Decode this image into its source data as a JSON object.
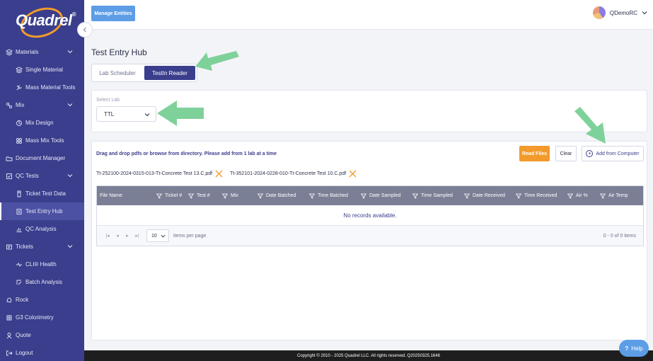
{
  "brand": {
    "name": "Quadrel",
    "reg": "®"
  },
  "topbar": {
    "manage_label": "Manage Entities",
    "user_name": "QDemoRC"
  },
  "sidebar": {
    "items": [
      {
        "label": "Materials",
        "level": "top",
        "icon": "layers-icon",
        "expandable": true
      },
      {
        "label": "Single Material",
        "level": "sub",
        "icon": "layers-icon"
      },
      {
        "label": "Mass Material Tools",
        "level": "sub",
        "icon": "tools-icon"
      },
      {
        "label": "Mix",
        "level": "top",
        "icon": "mix-icon",
        "expandable": true
      },
      {
        "label": "Mix Design",
        "level": "sub",
        "icon": "mix-design-icon"
      },
      {
        "label": "Mass Mix Tools",
        "level": "sub",
        "icon": "mass-mix-icon"
      },
      {
        "label": "Document Manager",
        "level": "top",
        "icon": "folder-icon"
      },
      {
        "label": "QC Tests",
        "level": "top",
        "icon": "qc-icon",
        "expandable": true
      },
      {
        "label": "Ticket Test Data",
        "level": "sub",
        "icon": "ticket-icon"
      },
      {
        "label": "Test Entry Hub",
        "level": "sub",
        "icon": "hub-icon",
        "active": true
      },
      {
        "label": "QC Analysis",
        "level": "sub",
        "icon": "chart-icon"
      },
      {
        "label": "Tickets",
        "level": "top",
        "icon": "tickets-icon",
        "expandable": true
      },
      {
        "label": "CLI® Health",
        "level": "sub",
        "icon": "health-icon"
      },
      {
        "label": "Batch Analysis",
        "level": "sub",
        "icon": "batch-icon"
      },
      {
        "label": "Rock",
        "level": "top",
        "icon": "rock-icon"
      },
      {
        "label": "G3 Colorimetry",
        "level": "top",
        "icon": "colorimetry-icon"
      },
      {
        "label": "Quote",
        "level": "top",
        "icon": "quote-icon"
      },
      {
        "label": "Logout",
        "level": "top",
        "icon": "logout-icon"
      }
    ]
  },
  "page": {
    "title": "Test Entry Hub",
    "tabs": [
      {
        "label": "Lab Scheduler",
        "active": false
      },
      {
        "label": "TestIn Reader",
        "active": true
      }
    ]
  },
  "lab": {
    "label": "Select Lab",
    "value": "TTL"
  },
  "upload": {
    "instructions": "Drag and drop pdfs or browse from directory. Please add from 1 lab at a time",
    "read_label": "Read Files",
    "clear_label": "Clear",
    "add_label": "Add from Computer",
    "files": [
      "Tt-252100-2024-0315-013-Tt-Concrete Test 13.C.pdf",
      "Tt-352101-2024-0228-010-Tt-Concrete Test 10.C.pdf"
    ]
  },
  "grid": {
    "columns": [
      {
        "label": "File Name",
        "filter": false
      },
      {
        "label": "Ticket #",
        "filter": true
      },
      {
        "label": "Test #",
        "filter": true
      },
      {
        "label": "Mix",
        "filter": true
      },
      {
        "label": "Date Batched",
        "filter": true
      },
      {
        "label": "Time Batched",
        "filter": true
      },
      {
        "label": "Date Sampled",
        "filter": true
      },
      {
        "label": "Time Sampled",
        "filter": true
      },
      {
        "label": "Date Received",
        "filter": true
      },
      {
        "label": "Time Received",
        "filter": true
      },
      {
        "label": "Air %",
        "filter": true
      },
      {
        "label": "Air Temp",
        "filter": true
      }
    ],
    "empty_text": "No records available.",
    "page_size": "10",
    "per_page_label": "items per page",
    "info": "0 - 0 of 0 items"
  },
  "footer": {
    "copyright": "Copyright © 2010 - 2025 Quadrel LLC. All rights reserved. Q20250325.1646"
  },
  "help": {
    "label": "Help"
  },
  "colors": {
    "sidebar": "#3a3e8c",
    "accent_orange": "#f39a2c",
    "accent_blue": "#5c9de6",
    "arrow_green": "#7fd19a"
  }
}
